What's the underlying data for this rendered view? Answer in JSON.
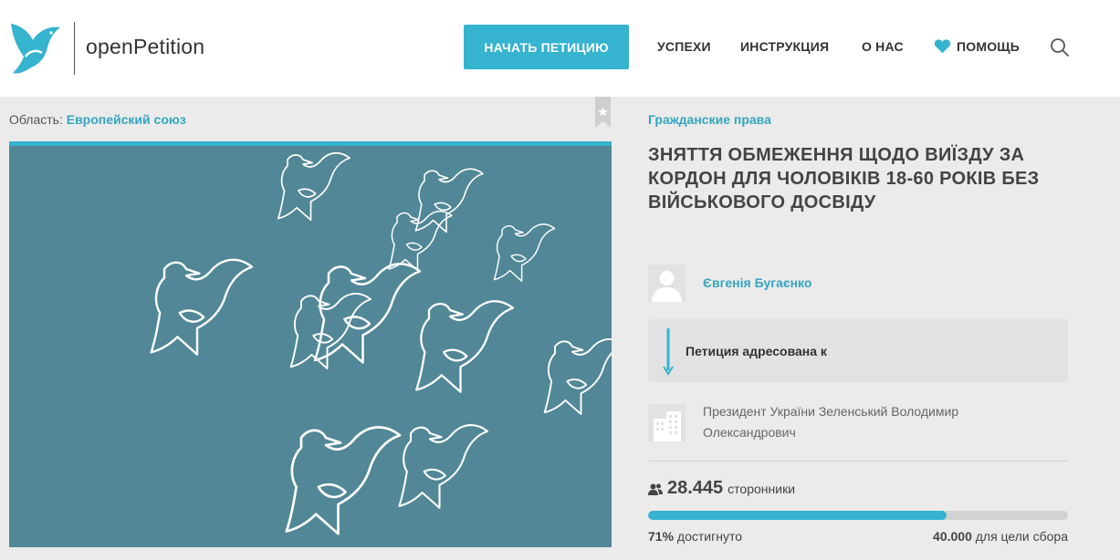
{
  "header": {
    "logo_text": "openPetition",
    "cta_label": "НАЧАТЬ ПЕТИЦИЮ",
    "nav": {
      "successes": "УСПЕХИ",
      "instructions": "ИНСТРУКЦИЯ",
      "about": "О НАС",
      "help": "ПОМОЩЬ"
    },
    "icons": {
      "logo": "dove-logo-icon",
      "help": "heart-icon",
      "search": "search-icon"
    }
  },
  "petition": {
    "region_label": "Область:",
    "region_value": "Европейский союз",
    "category": "Гражданские права",
    "title": "ЗНЯТТЯ ОБМЕЖЕННЯ ЩОДО ВИЇЗДУ ЗА КОРДОН ДЛЯ ЧОЛОВІКІВ 18-60 РОКІВ БЕЗ ВІЙСЬКОВОГО ДОСВІДУ",
    "author": "Євгенія Бугаєнко",
    "addressed_to_label": "Петиция адресована к",
    "recipient": "Президент України Зеленський Володимир Олександрович",
    "supporters_count": "28.445",
    "supporters_label": "сторонники",
    "progress_percent": 71,
    "progress_text_value": "71%",
    "progress_text_label": "достигнуто",
    "goal_value": "40.000",
    "goal_label": "для цели сбора"
  },
  "colors": {
    "accent": "#35b3cf",
    "link": "#35a5bf",
    "hero_bg": "#518797"
  }
}
